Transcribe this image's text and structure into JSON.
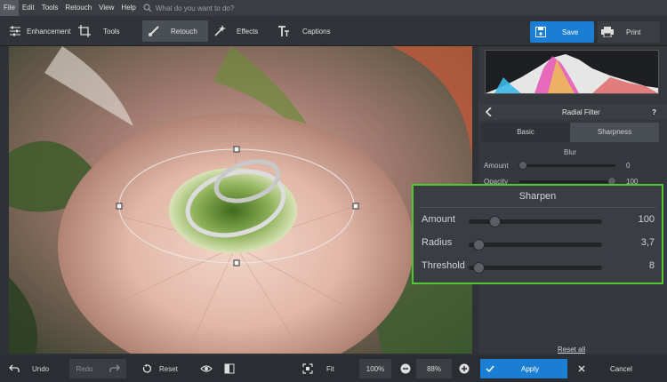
{
  "menu": {
    "items": [
      "File",
      "Edit",
      "Tools",
      "Retouch",
      "View",
      "Help"
    ],
    "search_placeholder": "What do you want to do?"
  },
  "toolbar": {
    "enhancement": "Enhancement",
    "tools": "Tools",
    "retouch": "Retouch",
    "effects": "Effects",
    "captions": "Captions",
    "save": "Save",
    "print": "Print"
  },
  "panel": {
    "title": "Radial Filter",
    "help": "?",
    "tabs": [
      "Basic",
      "Sharpness"
    ],
    "active_tab": "Sharpness",
    "blur": {
      "section": "Blur",
      "amount_label": "Amount",
      "amount_value": "0",
      "opacity_label": "Opacity",
      "opacity_value": "100"
    },
    "sharpen": {
      "section": "Sharpen",
      "amount_label": "Amount",
      "amount_value": "100",
      "radius_label": "Radius",
      "radius_value": "3,7",
      "threshold_label": "Threshold",
      "threshold_value": "8"
    },
    "reset_all": "Reset all"
  },
  "bottom": {
    "undo": "Undo",
    "redo": "Redo",
    "reset": "Reset",
    "fit": "Fit",
    "zoom_100": "100%",
    "zoom_current": "88%",
    "apply": "Apply",
    "cancel": "Cancel"
  },
  "colors": {
    "accent": "#1a7fd4",
    "highlight": "#50c832"
  }
}
